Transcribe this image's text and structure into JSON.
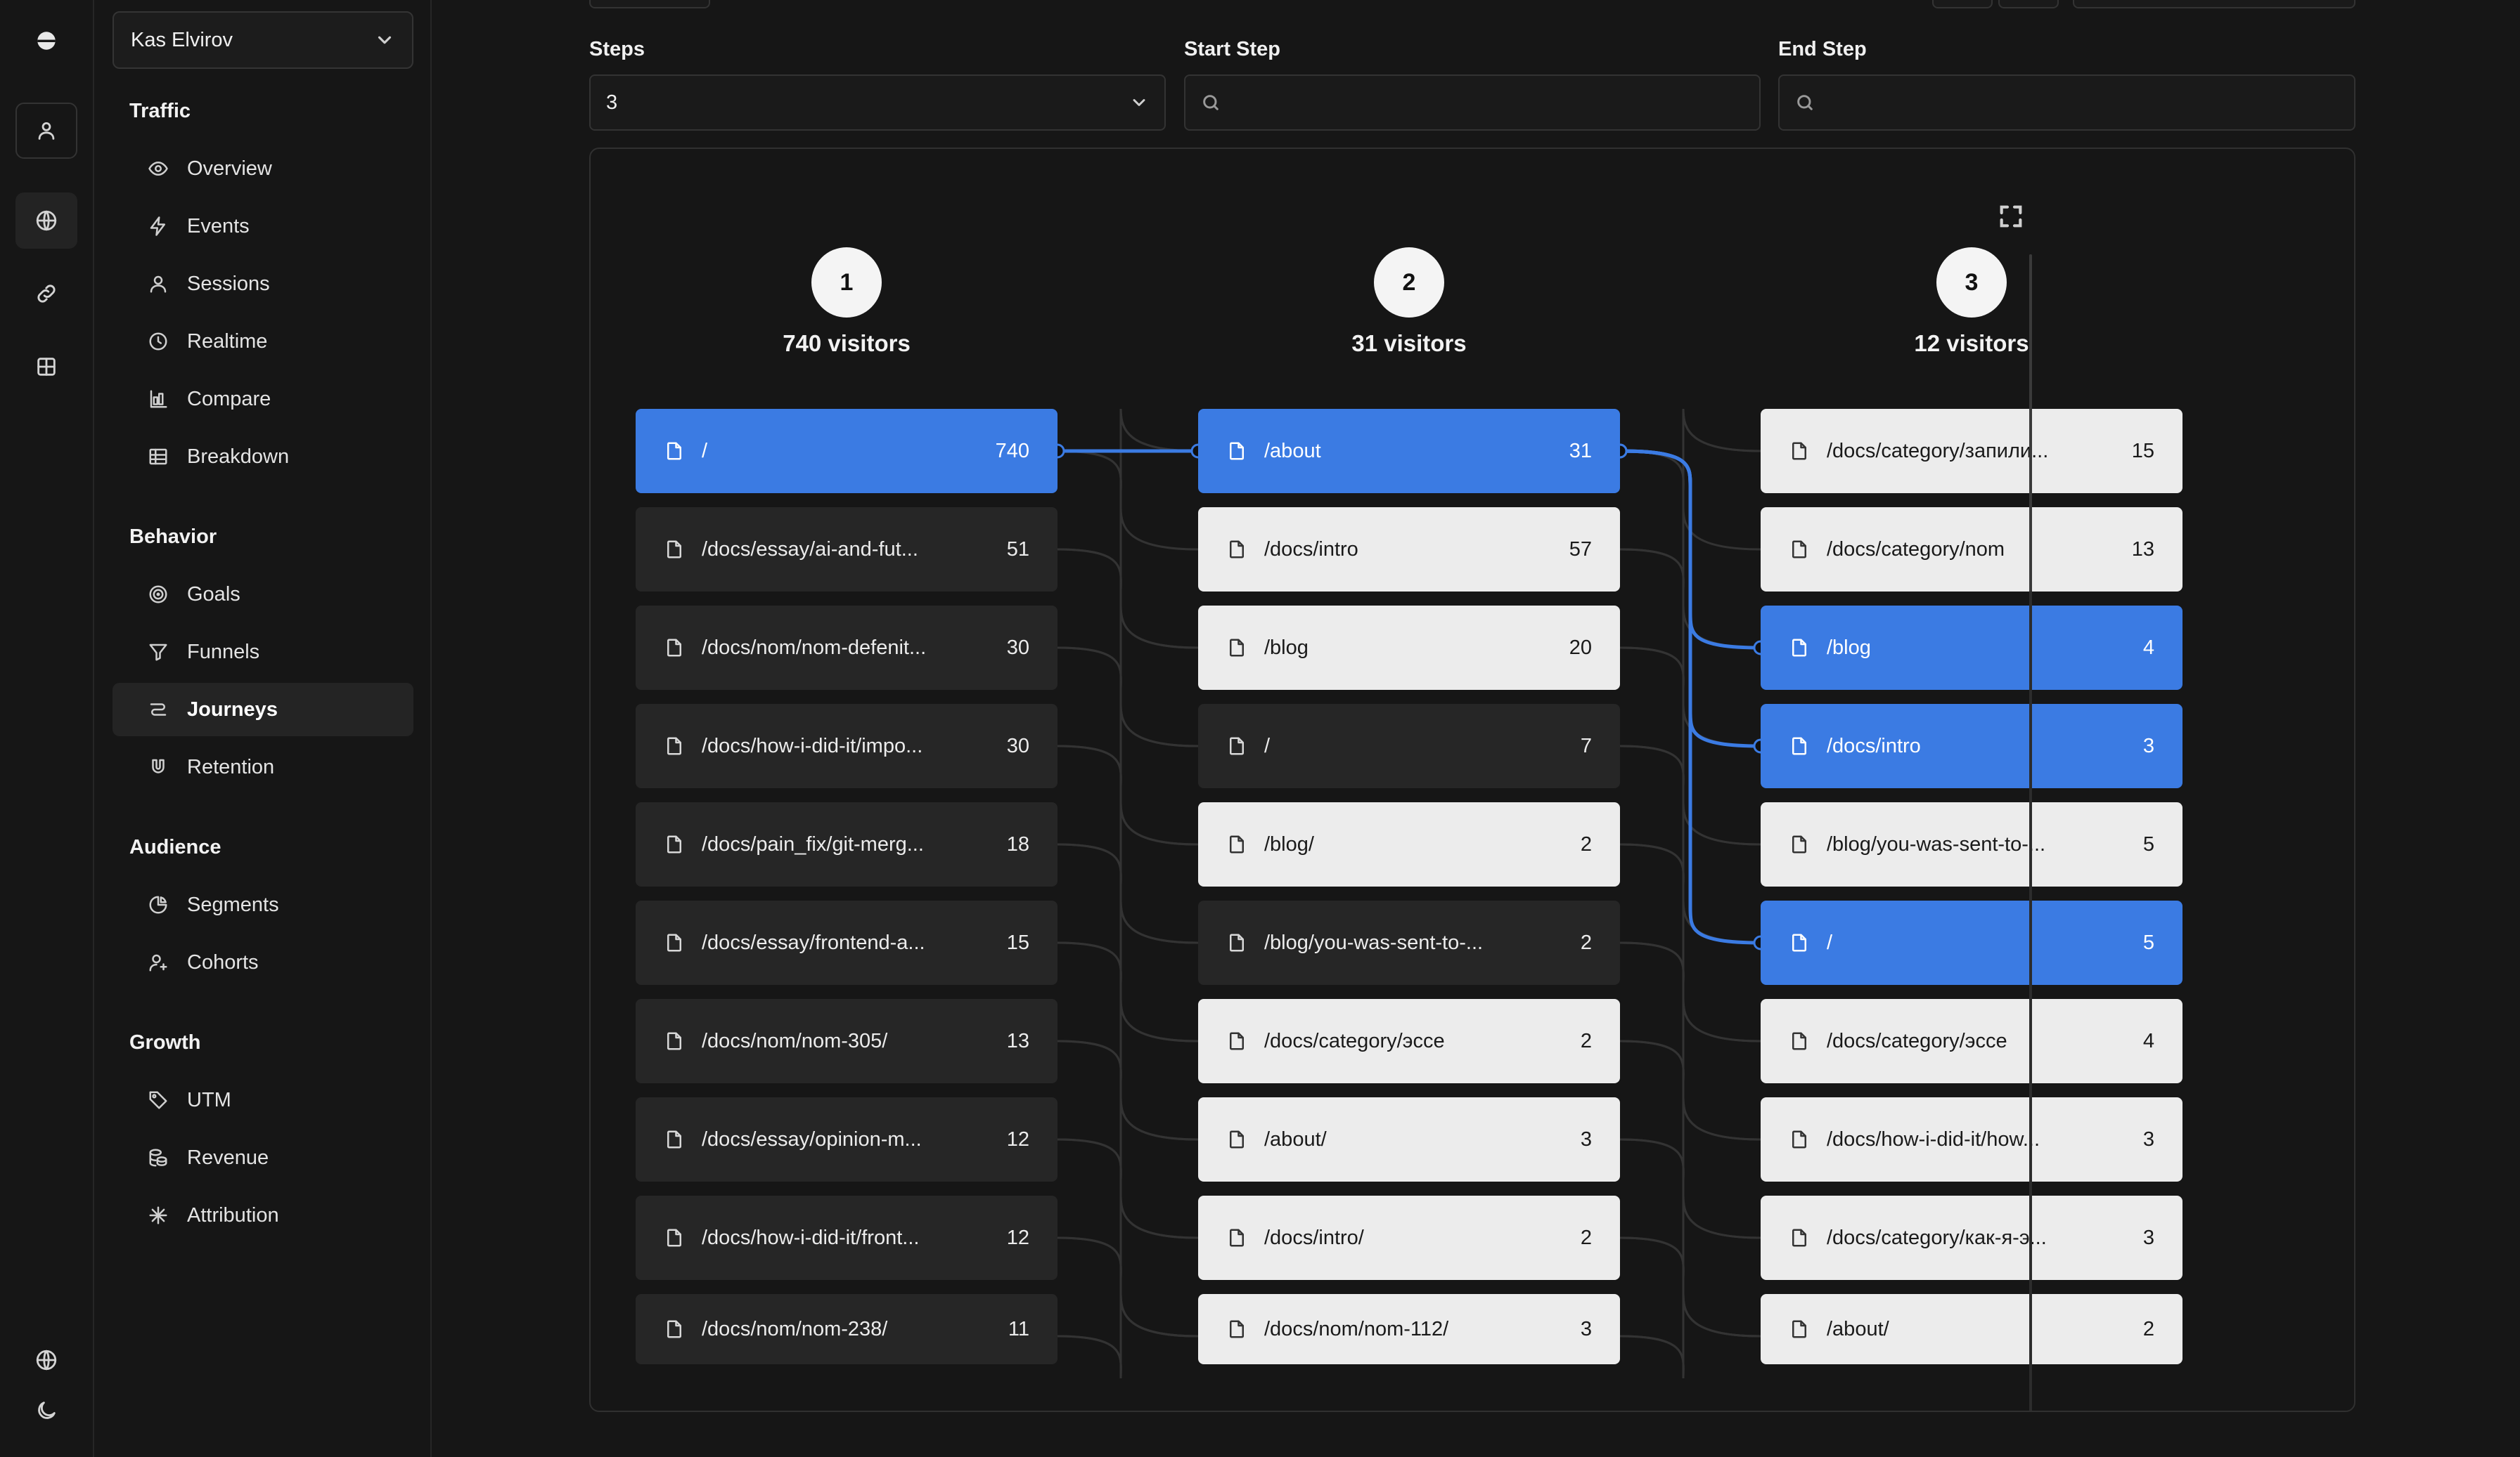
{
  "sidebar": {
    "site": "Kas Elvirov",
    "sections": [
      {
        "title": "Traffic",
        "items": [
          {
            "label": "Overview",
            "icon": "eye-icon"
          },
          {
            "label": "Events",
            "icon": "bolt-icon"
          },
          {
            "label": "Sessions",
            "icon": "user-icon"
          },
          {
            "label": "Realtime",
            "icon": "clock-icon"
          },
          {
            "label": "Compare",
            "icon": "bar-chart-icon"
          },
          {
            "label": "Breakdown",
            "icon": "table-icon"
          }
        ]
      },
      {
        "title": "Behavior",
        "items": [
          {
            "label": "Goals",
            "icon": "target-icon"
          },
          {
            "label": "Funnels",
            "icon": "funnel-icon"
          },
          {
            "label": "Journeys",
            "icon": "route-icon",
            "active": true
          },
          {
            "label": "Retention",
            "icon": "magnet-icon"
          }
        ]
      },
      {
        "title": "Audience",
        "items": [
          {
            "label": "Segments",
            "icon": "pie-icon"
          },
          {
            "label": "Cohorts",
            "icon": "user-plus-icon"
          }
        ]
      },
      {
        "title": "Growth",
        "items": [
          {
            "label": "UTM",
            "icon": "tag-icon"
          },
          {
            "label": "Revenue",
            "icon": "coins-icon"
          },
          {
            "label": "Attribution",
            "icon": "network-icon"
          }
        ]
      }
    ]
  },
  "filters": {
    "steps_label": "Steps",
    "steps_value": "3",
    "start_label": "Start Step",
    "start_value": "",
    "end_label": "End Step",
    "end_value": ""
  },
  "journey": {
    "columns": [
      {
        "step": "1",
        "visitors": "740 visitors",
        "nodes": [
          {
            "path": "/",
            "count": "740",
            "style": "blue"
          },
          {
            "path": "/docs/essay/ai-and-fut...",
            "count": "51",
            "style": "dark"
          },
          {
            "path": "/docs/nom/nom-defenit...",
            "count": "30",
            "style": "dark"
          },
          {
            "path": "/docs/how-i-did-it/impo...",
            "count": "30",
            "style": "dark"
          },
          {
            "path": "/docs/pain_fix/git-merg...",
            "count": "18",
            "style": "dark"
          },
          {
            "path": "/docs/essay/frontend-a...",
            "count": "15",
            "style": "dark"
          },
          {
            "path": "/docs/nom/nom-305/",
            "count": "13",
            "style": "dark"
          },
          {
            "path": "/docs/essay/opinion-m...",
            "count": "12",
            "style": "dark"
          },
          {
            "path": "/docs/how-i-did-it/front...",
            "count": "12",
            "style": "dark"
          },
          {
            "path": "/docs/nom/nom-238/",
            "count": "11",
            "style": "dark"
          }
        ]
      },
      {
        "step": "2",
        "visitors": "31 visitors",
        "nodes": [
          {
            "path": "/about",
            "count": "31",
            "style": "blue"
          },
          {
            "path": "/docs/intro",
            "count": "57",
            "style": "light"
          },
          {
            "path": "/blog",
            "count": "20",
            "style": "light"
          },
          {
            "path": "/",
            "count": "7",
            "style": "dark"
          },
          {
            "path": "/blog/",
            "count": "2",
            "style": "light"
          },
          {
            "path": "/blog/you-was-sent-to-...",
            "count": "2",
            "style": "dark"
          },
          {
            "path": "/docs/category/эссе",
            "count": "2",
            "style": "light"
          },
          {
            "path": "/about/",
            "count": "3",
            "style": "light"
          },
          {
            "path": "/docs/intro/",
            "count": "2",
            "style": "light"
          },
          {
            "path": "/docs/nom/nom-112/",
            "count": "3",
            "style": "light"
          }
        ]
      },
      {
        "step": "3",
        "visitors": "12 visitors",
        "nodes": [
          {
            "path": "/docs/category/запили...",
            "count": "15",
            "style": "light"
          },
          {
            "path": "/docs/category/nom",
            "count": "13",
            "style": "light"
          },
          {
            "path": "/blog",
            "count": "4",
            "style": "blue"
          },
          {
            "path": "/docs/intro",
            "count": "3",
            "style": "blue"
          },
          {
            "path": "/blog/you-was-sent-to-...",
            "count": "5",
            "style": "light"
          },
          {
            "path": "/",
            "count": "5",
            "style": "blue"
          },
          {
            "path": "/docs/category/эссе",
            "count": "4",
            "style": "light"
          },
          {
            "path": "/docs/how-i-did-it/how...",
            "count": "3",
            "style": "light"
          },
          {
            "path": "/docs/category/как-я-э...",
            "count": "3",
            "style": "light"
          },
          {
            "path": "/about/",
            "count": "2",
            "style": "light"
          }
        ]
      }
    ],
    "highlight_color": "#3b7be3",
    "highlighted_links": [
      {
        "from": [
          0,
          0
        ],
        "to": [
          1,
          0
        ]
      },
      {
        "from": [
          1,
          0
        ],
        "to": [
          2,
          2
        ]
      },
      {
        "from": [
          1,
          0
        ],
        "to": [
          2,
          3
        ]
      },
      {
        "from": [
          1,
          0
        ],
        "to": [
          2,
          5
        ]
      }
    ]
  }
}
